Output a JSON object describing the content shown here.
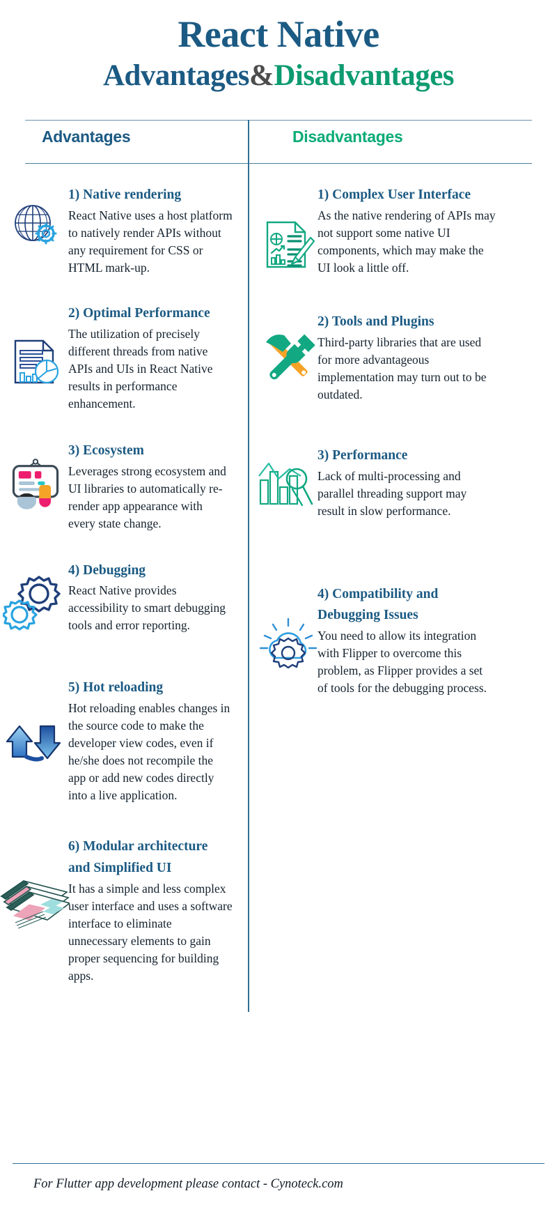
{
  "header": {
    "title_line1": "React Native",
    "title_line2_part1": "Advantages",
    "title_line2_amp": "&",
    "title_line2_part2": "Disadvantages"
  },
  "colors": {
    "deep_blue": "#1b5a83",
    "green": "#0d9b70",
    "amp_gray": "#4d4d4d",
    "divider": "#2e6f94",
    "body_text": "#14222e"
  },
  "columns": {
    "advantages_header": "Advantages",
    "disadvantages_header": "Disadvantages"
  },
  "advantages": [
    {
      "icon": "globe-gear-icon",
      "title": "1) Native rendering",
      "body": "React Native uses a host platform to natively render APIs without any requirement for CSS or HTML mark-up."
    },
    {
      "icon": "document-chart-icon",
      "title": "2) Optimal Performance",
      "body": "The utilization of precisely different threads from native APIs and UIs in React Native results in performance enhancement."
    },
    {
      "icon": "ui-components-icon",
      "title": "3) Ecosystem",
      "body": "Leverages strong ecosystem and UI libraries to automatically re-render app appearance with every state change."
    },
    {
      "icon": "gears-debug-icon",
      "title": "4) Debugging",
      "body": "React Native provides accessibility to smart debugging tools and error reporting."
    },
    {
      "icon": "reload-arrows-icon",
      "title": "5) Hot reloading",
      "body": "Hot reloading enables changes in the source code to make the developer view codes, even if he/she does not recompile the app or add new codes directly into a live application."
    },
    {
      "icon": "stacked-windows-icon",
      "title": "6) Modular architecture and Simplified UI",
      "body": "It has a simple and less complex user interface and uses a software interface to eliminate unnecessary elements to gain proper sequencing for building apps."
    }
  ],
  "disadvantages": [
    {
      "icon": "document-pencil-icon",
      "title": "1) Complex User Interface",
      "body": "As the native rendering of APIs may not support some native UI components, which may make the UI look a little off."
    },
    {
      "icon": "hammer-wrench-icon",
      "title": "2) Tools and Plugins",
      "body": "Third-party libraries that are used for more advantageous implementation may turn out to be outdated."
    },
    {
      "icon": "bar-chart-magnifier-icon",
      "title": "3) Performance",
      "body": "Lack of multi-processing and parallel threading support may result in slow performance."
    },
    {
      "icon": "cloud-gear-icon",
      "title": "4) Compatibility and Debugging Issues",
      "body": "You need to allow its integration with Flipper to overcome this problem, as Flipper provides a set of tools for the debugging process."
    }
  ],
  "footer": {
    "text": "For Flutter app development please contact - Cynoteck.com"
  }
}
